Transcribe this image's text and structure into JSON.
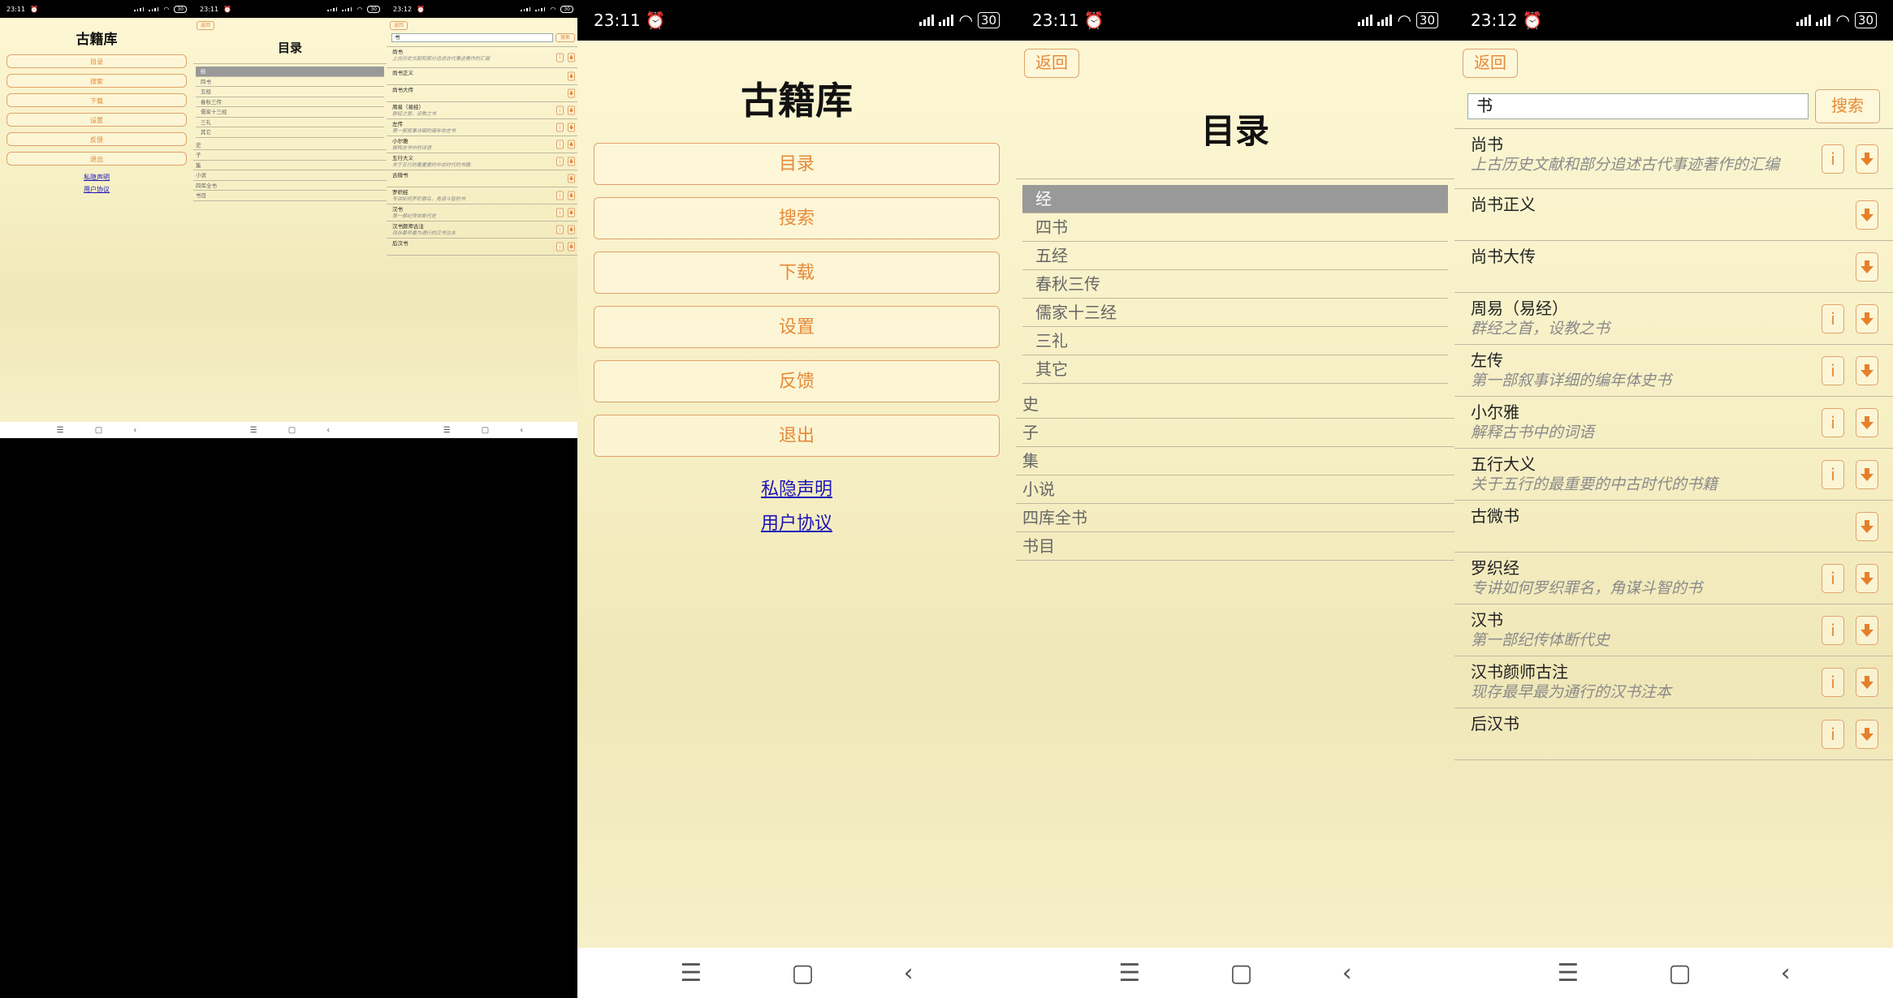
{
  "status": {
    "time_home": "23:11",
    "time_catalog": "23:11",
    "time_search": "23:12",
    "battery": "30"
  },
  "home": {
    "title": "古籍库",
    "buttons": [
      "目录",
      "搜索",
      "下载",
      "设置",
      "反馈",
      "退出"
    ],
    "links": [
      "私隐声明",
      "用户协议"
    ]
  },
  "common": {
    "back_label": "返回"
  },
  "catalog": {
    "title": "目录",
    "selected": "经",
    "sub_items": [
      "四书",
      "五经",
      "春秋三传",
      "儒家十三经",
      "三礼",
      "其它"
    ],
    "top_items": [
      "史",
      "子",
      "集",
      "小说",
      "四库全书",
      "书目"
    ]
  },
  "search": {
    "query": "书",
    "button_label": "搜索",
    "results": [
      {
        "title": "尚书",
        "desc": "上古历史文献和部分追述古代事迹著作的汇编",
        "info": true
      },
      {
        "title": "尚书正义",
        "desc": "",
        "info": false
      },
      {
        "title": "尚书大传",
        "desc": "",
        "info": false
      },
      {
        "title": "周易（易经）",
        "desc": "群经之首，设教之书",
        "info": true
      },
      {
        "title": "左传",
        "desc": "第一部叙事详细的编年体史书",
        "info": true
      },
      {
        "title": "小尔雅",
        "desc": "解释古书中的词语",
        "info": true
      },
      {
        "title": "五行大义",
        "desc": "关于五行的最重要的中古时代的书籍",
        "info": true
      },
      {
        "title": "古微书",
        "desc": "",
        "info": false
      },
      {
        "title": "罗织经",
        "desc": "专讲如何罗织罪名，角谋斗智的书",
        "info": true
      },
      {
        "title": "汉书",
        "desc": "第一部纪传体断代史",
        "info": true
      },
      {
        "title": "汉书颜师古注",
        "desc": "现存最早最为通行的汉书注本",
        "info": true
      },
      {
        "title": "后汉书",
        "desc": "",
        "info": true
      }
    ]
  },
  "icons": {
    "info": "i",
    "nav_menu": "☰",
    "nav_home": "▢",
    "nav_back": "‹"
  },
  "colors": {
    "accent": "#e58a38",
    "selected_bg": "#999999",
    "link": "#1b14b8"
  }
}
